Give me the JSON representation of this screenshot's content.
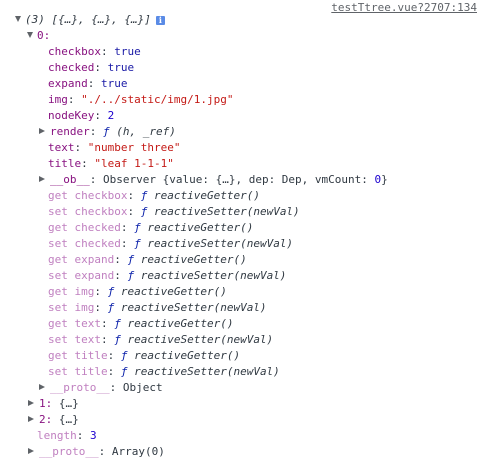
{
  "source_link": "testTtree.vue?2707:134",
  "root": {
    "summary": "(3) [{…}, {…}, {…}]",
    "info_icon": "i"
  },
  "item0": {
    "key": "0:",
    "props": [
      {
        "k": "checkbox",
        "v": "true",
        "type": "kw"
      },
      {
        "k": "checked",
        "v": "true",
        "type": "kw"
      },
      {
        "k": "expand",
        "v": "true",
        "type": "kw"
      },
      {
        "k": "img",
        "v": "\"./../static/img/1.jpg\"",
        "type": "str"
      },
      {
        "k": "nodeKey",
        "v": "2",
        "type": "num"
      }
    ],
    "render": {
      "k": "render",
      "f": "ƒ",
      "sig": " (h, _ref)"
    },
    "props2": [
      {
        "k": "text",
        "v": "\"number three\"",
        "type": "str"
      },
      {
        "k": "title",
        "v": "\"leaf 1-1-1\"",
        "type": "str"
      }
    ],
    "ob": {
      "k": "__ob__",
      "v1": "Observer {value: {…}, dep: Dep, vmCount: ",
      "v2": "0",
      "v3": "}"
    },
    "accessors": [
      {
        "k": "get checkbox",
        "sig": "reactiveGetter()"
      },
      {
        "k": "set checkbox",
        "sig": "reactiveSetter(newVal)"
      },
      {
        "k": "get checked",
        "sig": "reactiveGetter()"
      },
      {
        "k": "set checked",
        "sig": "reactiveSetter(newVal)"
      },
      {
        "k": "get expand",
        "sig": "reactiveGetter()"
      },
      {
        "k": "set expand",
        "sig": "reactiveSetter(newVal)"
      },
      {
        "k": "get img",
        "sig": "reactiveGetter()"
      },
      {
        "k": "set img",
        "sig": "reactiveSetter(newVal)"
      },
      {
        "k": "get text",
        "sig": "reactiveGetter()"
      },
      {
        "k": "set text",
        "sig": "reactiveSetter(newVal)"
      },
      {
        "k": "get title",
        "sig": "reactiveGetter()"
      },
      {
        "k": "set title",
        "sig": "reactiveSetter(newVal)"
      }
    ],
    "proto": {
      "k": "__proto__",
      "v": "Object"
    }
  },
  "item1": {
    "k": "1:",
    "v": "{…}"
  },
  "item2": {
    "k": "2:",
    "v": "{…}"
  },
  "length": {
    "k": "length",
    "v": "3"
  },
  "array_proto": {
    "k": "__proto__",
    "v": "Array(0)"
  },
  "f_symbol": "ƒ",
  "colon": ": "
}
